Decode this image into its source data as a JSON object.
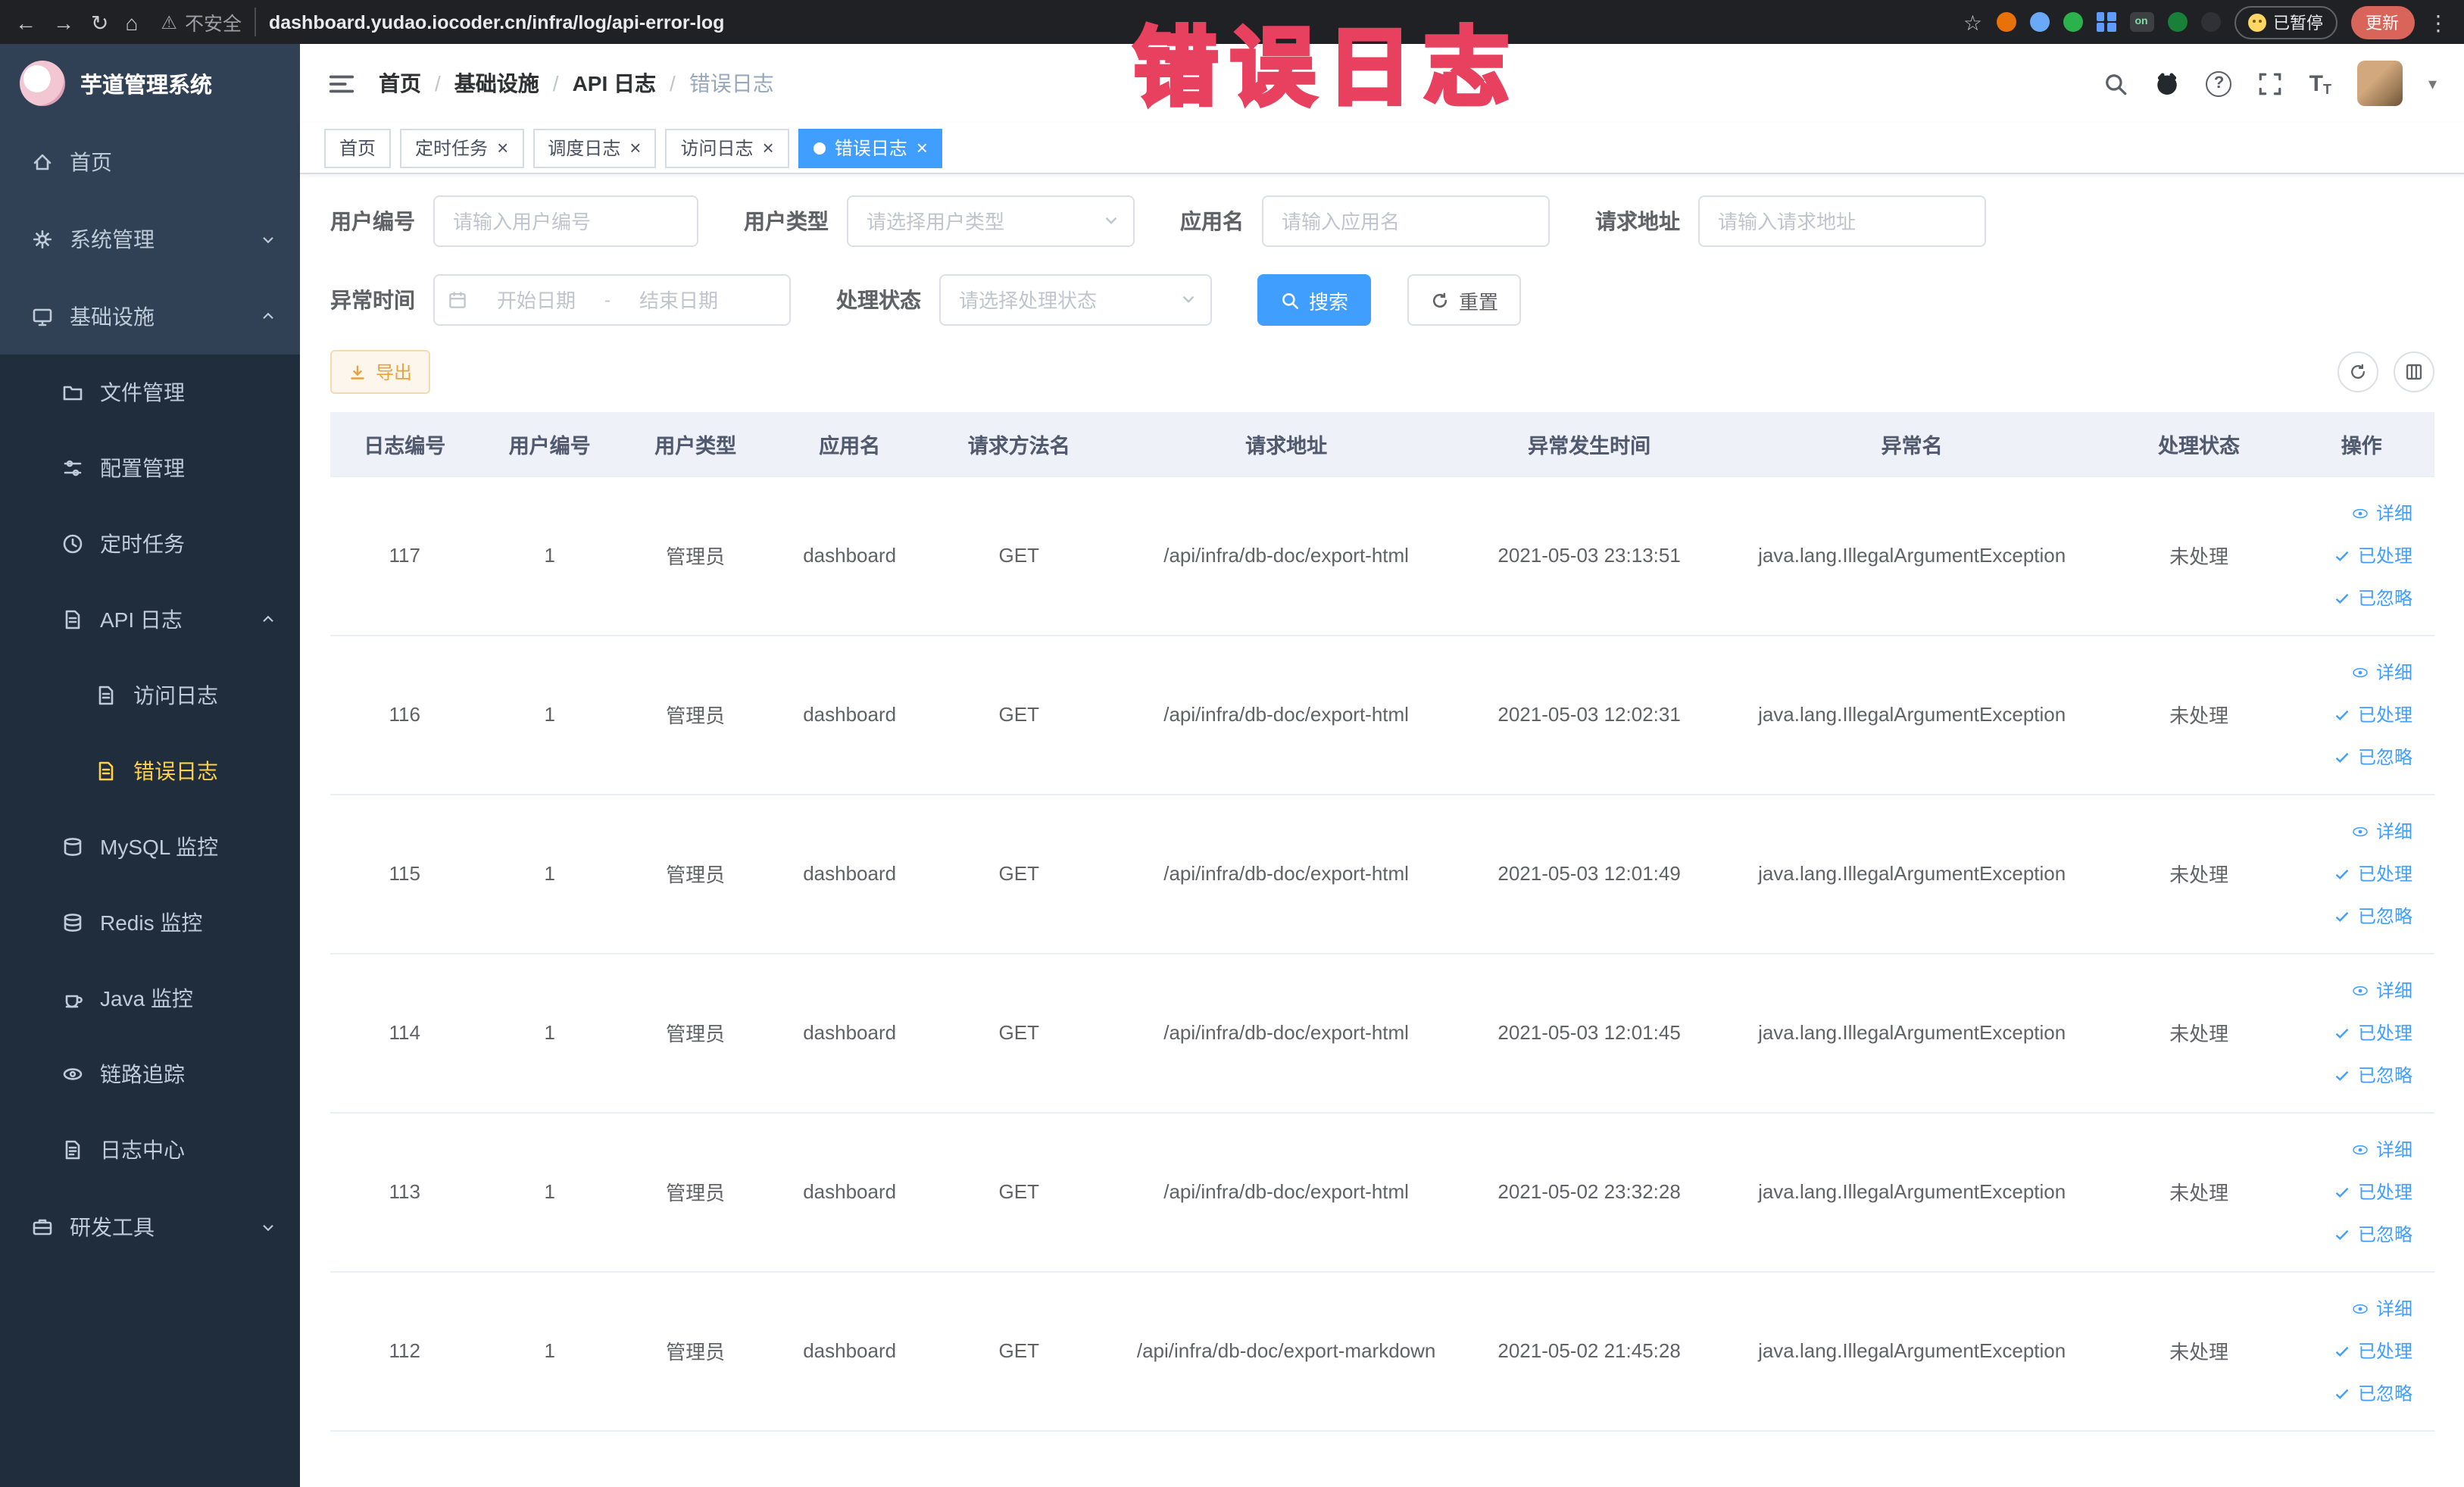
{
  "colors": {
    "primary": "#409eff",
    "sidebar_bg": "#304156",
    "submenu_bg": "#1f2d3d",
    "active_menu_text": "#ffd04b",
    "tag_active_bg": "#409eff",
    "warning_button_text": "#e6a23c",
    "annotation_red": "#e8415f",
    "update_button_bg": "#d96459",
    "paused_smiley": "#fdd663"
  },
  "glyphs": {
    "back": "←",
    "forward": "→",
    "reload": "↻",
    "home": "⌂",
    "warning": "⚠",
    "star": "☆",
    "kebab": "⋮",
    "close": "×",
    "caret_down": "▾",
    "question": "?",
    "text_size": "T"
  },
  "annotation": {
    "text": "错误日志"
  },
  "browser": {
    "security_label": "不安全",
    "url": "dashboard.yudao.iocoder.cn/infra/log/api-error-log",
    "extension_on_label": "on",
    "paused_label": "已暂停",
    "update_label": "更新"
  },
  "sidebar": {
    "logo_title": "芋道管理系统",
    "items": [
      {
        "label": "首页"
      },
      {
        "label": "系统管理"
      },
      {
        "label": "基础设施",
        "children": [
          {
            "label": "文件管理"
          },
          {
            "label": "配置管理"
          },
          {
            "label": "定时任务"
          },
          {
            "label": "API 日志",
            "children": [
              {
                "label": "访问日志"
              },
              {
                "label": "错误日志",
                "active": true
              }
            ]
          },
          {
            "label": "MySQL 监控"
          },
          {
            "label": "Redis 监控"
          },
          {
            "label": "Java 监控"
          },
          {
            "label": "链路追踪"
          },
          {
            "label": "日志中心"
          }
        ]
      },
      {
        "label": "研发工具"
      }
    ]
  },
  "header": {
    "breadcrumb": [
      "首页",
      "基础设施",
      "API 日志",
      "错误日志"
    ],
    "separator": "/"
  },
  "tabs": [
    {
      "label": "首页",
      "closable": false,
      "active": false
    },
    {
      "label": "定时任务",
      "closable": true,
      "active": false
    },
    {
      "label": "调度日志",
      "closable": true,
      "active": false
    },
    {
      "label": "访问日志",
      "closable": true,
      "active": false
    },
    {
      "label": "错误日志",
      "closable": true,
      "active": true
    }
  ],
  "filters": {
    "user_id_label": "用户编号",
    "user_id_placeholder": "请输入用户编号",
    "user_type_label": "用户类型",
    "user_type_placeholder": "请选择用户类型",
    "app_name_label": "应用名",
    "app_name_placeholder": "请输入应用名",
    "request_url_label": "请求地址",
    "request_url_placeholder": "请输入请求地址",
    "exception_time_label": "异常时间",
    "start_date_placeholder": "开始日期",
    "end_date_placeholder": "结束日期",
    "range_separator": "-",
    "process_status_label": "处理状态",
    "process_status_placeholder": "请选择处理状态",
    "search_button": "搜索",
    "reset_button": "重置"
  },
  "toolbar": {
    "export_label": "导出"
  },
  "table": {
    "columns": [
      "日志编号",
      "用户编号",
      "用户类型",
      "应用名",
      "请求方法名",
      "请求地址",
      "异常发生时间",
      "异常名",
      "处理状态",
      "操作"
    ],
    "action_labels": {
      "detail": "详细",
      "processed": "已处理",
      "ignored": "已忽略"
    },
    "rows": [
      {
        "id": "117",
        "user_id": "1",
        "user_type": "管理员",
        "app": "dashboard",
        "method": "GET",
        "url": "/api/infra/db-doc/export-html",
        "time": "2021-05-03 23:13:51",
        "exception": "java.lang.IllegalArgumentException",
        "status": "未处理"
      },
      {
        "id": "116",
        "user_id": "1",
        "user_type": "管理员",
        "app": "dashboard",
        "method": "GET",
        "url": "/api/infra/db-doc/export-html",
        "time": "2021-05-03 12:02:31",
        "exception": "java.lang.IllegalArgumentException",
        "status": "未处理"
      },
      {
        "id": "115",
        "user_id": "1",
        "user_type": "管理员",
        "app": "dashboard",
        "method": "GET",
        "url": "/api/infra/db-doc/export-html",
        "time": "2021-05-03 12:01:49",
        "exception": "java.lang.IllegalArgumentException",
        "status": "未处理"
      },
      {
        "id": "114",
        "user_id": "1",
        "user_type": "管理员",
        "app": "dashboard",
        "method": "GET",
        "url": "/api/infra/db-doc/export-html",
        "time": "2021-05-03 12:01:45",
        "exception": "java.lang.IllegalArgumentException",
        "status": "未处理"
      },
      {
        "id": "113",
        "user_id": "1",
        "user_type": "管理员",
        "app": "dashboard",
        "method": "GET",
        "url": "/api/infra/db-doc/export-html",
        "time": "2021-05-02 23:32:28",
        "exception": "java.lang.IllegalArgumentException",
        "status": "未处理"
      },
      {
        "id": "112",
        "user_id": "1",
        "user_type": "管理员",
        "app": "dashboard",
        "method": "GET",
        "url": "/api/infra/db-doc/export-markdown",
        "time": "2021-05-02 21:45:28",
        "exception": "java.lang.IllegalArgumentException",
        "status": "未处理"
      }
    ]
  }
}
